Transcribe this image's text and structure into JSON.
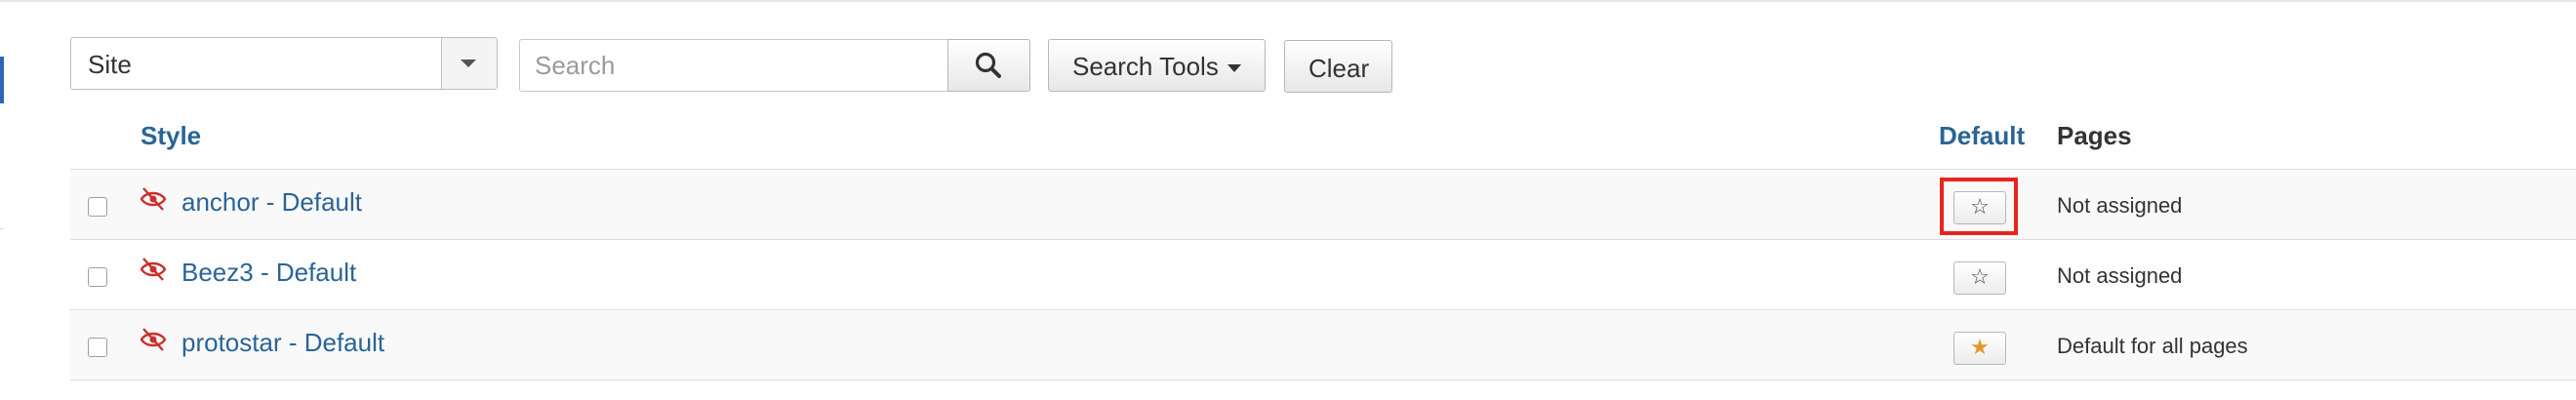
{
  "filters": {
    "site_select_value": "Site",
    "search_placeholder": "Search",
    "search_tools_label": "Search Tools",
    "clear_label": "Clear"
  },
  "table": {
    "columns": {
      "style": "Style",
      "default": "Default",
      "pages": "Pages"
    },
    "rows": [
      {
        "style": "anchor - Default",
        "default_star": "☆",
        "is_default": false,
        "pages": "Not assigned"
      },
      {
        "style": "Beez3 - Default",
        "default_star": "☆",
        "is_default": false,
        "pages": "Not assigned"
      },
      {
        "style": "protostar - Default",
        "default_star": "★",
        "is_default": true,
        "pages": "Default for all pages"
      }
    ]
  },
  "colors": {
    "link": "#2a6496",
    "hidden_icon": "#c9302c",
    "default_star": "#e09a2f",
    "highlight": "#e8251b"
  }
}
